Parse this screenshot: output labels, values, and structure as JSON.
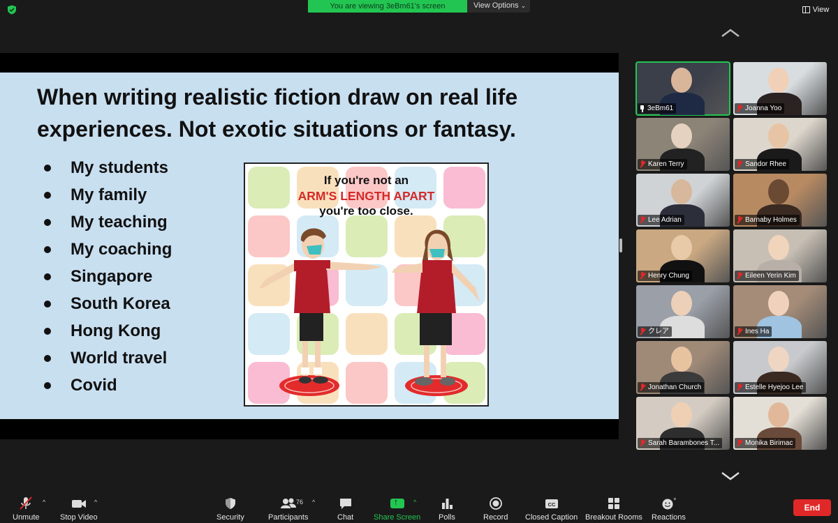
{
  "banner": {
    "viewing_text": "You are viewing 3eBm61's screen",
    "view_options_label": "View Options"
  },
  "top_right": {
    "view_label": "View"
  },
  "slide": {
    "title": "When writing realistic fiction draw on real life experiences. Not exotic situations or fantasy.",
    "bullets": [
      "My students",
      "My family",
      "My teaching",
      "My coaching",
      "Singapore",
      "South Korea",
      "Hong Kong",
      "World travel",
      "Covid"
    ],
    "poster": {
      "line1": "If you're not an",
      "line2": "ARM'S LENGTH APART",
      "line3": "you're too close."
    }
  },
  "participants": [
    {
      "name": "3eBm61",
      "active": true,
      "muted": false,
      "pinned": true
    },
    {
      "name": "Joanna Yoo",
      "muted": true
    },
    {
      "name": "Karen Terry",
      "muted": true
    },
    {
      "name": "Sandor Rhee",
      "muted": true
    },
    {
      "name": "Lee Adrian",
      "muted": true
    },
    {
      "name": "Barnaby Holmes",
      "muted": true
    },
    {
      "name": "Henry Chung",
      "muted": true
    },
    {
      "name": "Eileen Yerin Kim",
      "muted": true
    },
    {
      "name": "クレア",
      "muted": true
    },
    {
      "name": "Ines Ha",
      "muted": true
    },
    {
      "name": "Jonathan Church",
      "muted": true
    },
    {
      "name": "Estelle Hyejoo Lee",
      "muted": true
    },
    {
      "name": "Sarah Barambones T...",
      "muted": true
    },
    {
      "name": "Monika Birimac",
      "muted": true
    }
  ],
  "toolbar": {
    "unmute": "Unmute",
    "stop_video": "Stop Video",
    "security": "Security",
    "participants": "Participants",
    "participant_count": "76",
    "chat": "Chat",
    "share_screen": "Share Screen",
    "polls": "Polls",
    "record": "Record",
    "closed_caption": "Closed Caption",
    "breakout_rooms": "Breakout Rooms",
    "reactions": "Reactions",
    "end": "End"
  },
  "colors": {
    "accent_green": "#23c552",
    "end_red": "#e02828",
    "slide_bg": "#c8dff0"
  }
}
